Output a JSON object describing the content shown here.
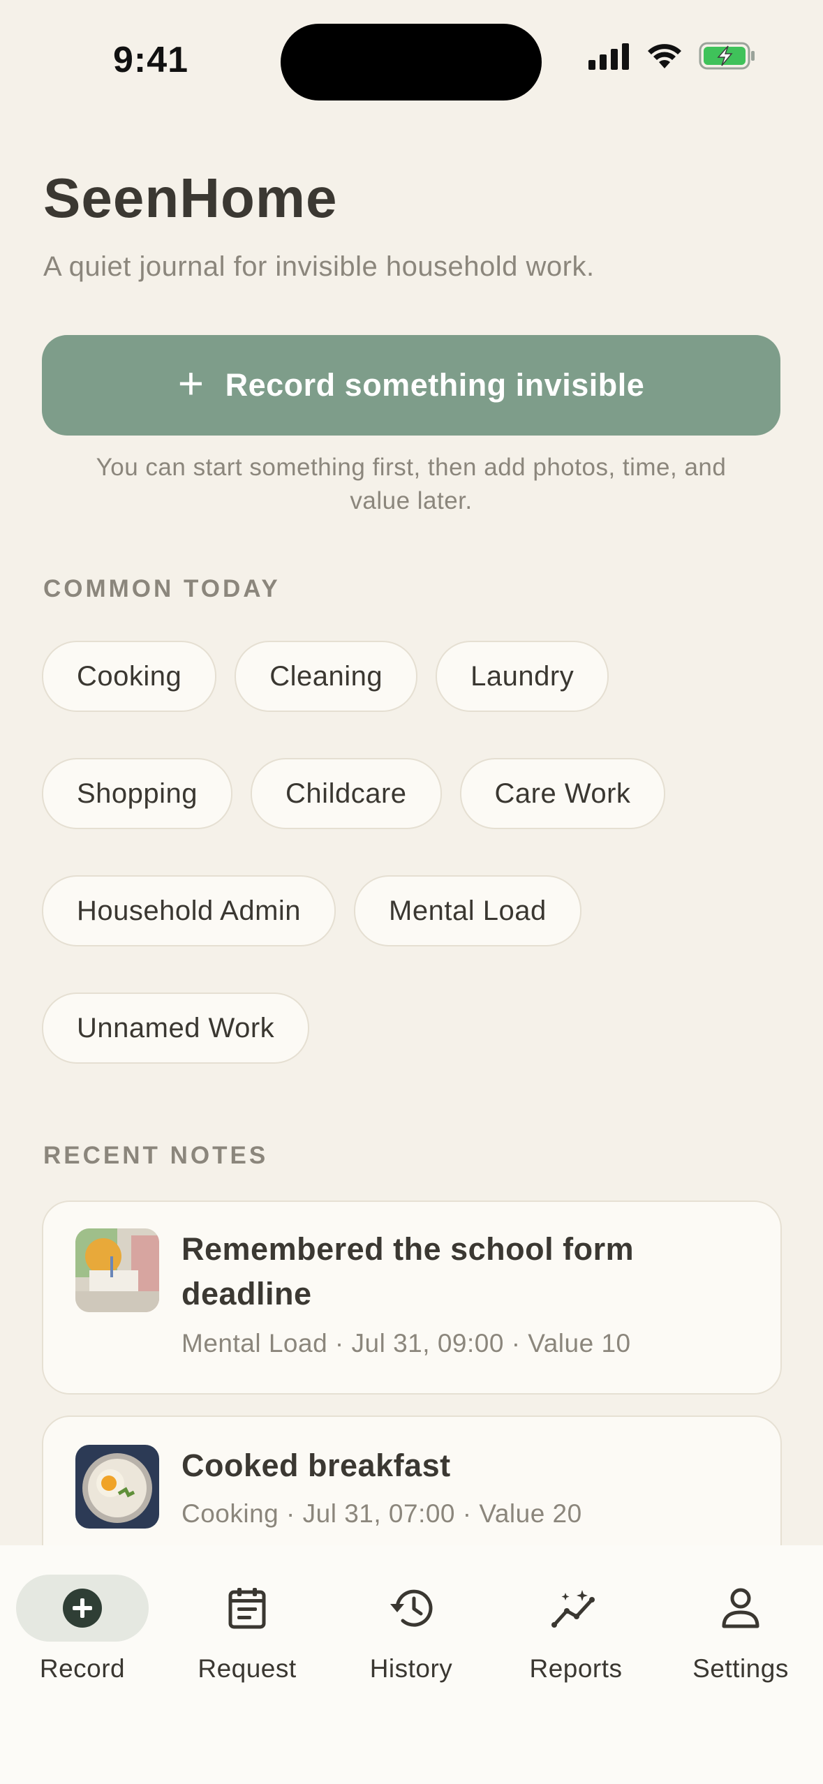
{
  "status_bar": {
    "time": "9:41"
  },
  "header": {
    "title": "SeenHome",
    "subtitle": "A quiet journal for invisible household work."
  },
  "record_button": {
    "icon": "plus-icon",
    "label": "Record something invisible"
  },
  "hint_line1": "You can start something first, then add photos, time, and",
  "hint_line2": "value later.",
  "common_today": {
    "label": "COMMON TODAY",
    "rows": [
      [
        "Cooking",
        "Cleaning",
        "Laundry"
      ],
      [
        "Shopping",
        "Childcare",
        "Care Work"
      ],
      [
        "Household Admin",
        "Mental Load"
      ],
      [
        "Unnamed Work"
      ]
    ]
  },
  "recent_notes": {
    "label": "RECENT NOTES",
    "items": [
      {
        "title_line1": "Remembered the school form",
        "title_line2": "deadline",
        "meta": "Mental Load · Jul 31, 09:00 · Value 10"
      },
      {
        "title_line1": "Cooked breakfast",
        "meta": "Cooking · Jul 31, 07:00 · Value 20"
      }
    ]
  },
  "tabs": [
    {
      "label": "Record",
      "icon": "plus-circle-icon",
      "active": true
    },
    {
      "label": "Request",
      "icon": "clipboard-icon"
    },
    {
      "label": "History",
      "icon": "history-icon"
    },
    {
      "label": "Reports",
      "icon": "trend-sparkle-icon"
    },
    {
      "label": "Settings",
      "icon": "person-icon"
    }
  ],
  "colors": {
    "accent": "#7e9d8a",
    "background": "#f5f1e9",
    "card": "#fcfaf5",
    "muted_text": "#8b867c"
  }
}
